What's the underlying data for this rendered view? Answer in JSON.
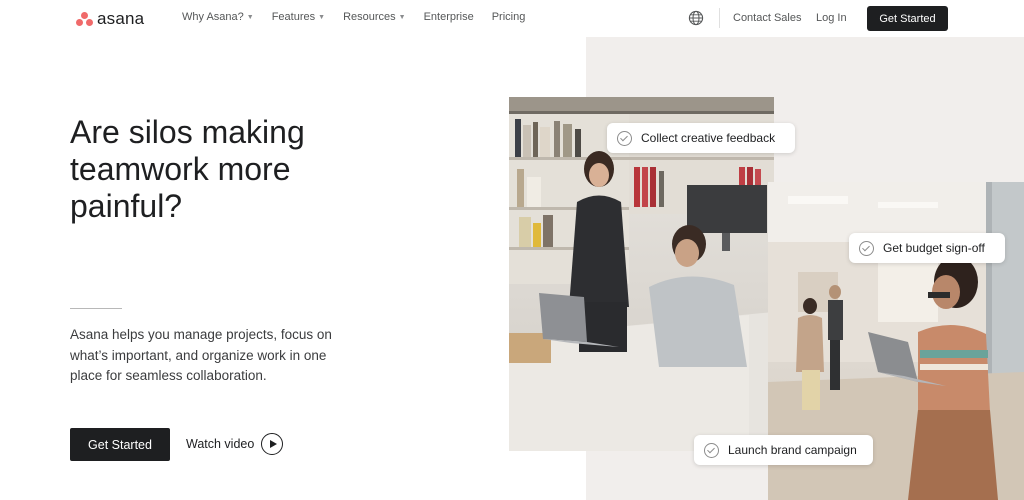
{
  "nav": {
    "logo_text": "asana",
    "links": [
      {
        "label": "Why Asana?",
        "has_dropdown": true
      },
      {
        "label": "Features",
        "has_dropdown": true
      },
      {
        "label": "Resources",
        "has_dropdown": true
      },
      {
        "label": "Enterprise",
        "has_dropdown": false
      },
      {
        "label": "Pricing",
        "has_dropdown": false
      }
    ],
    "globe_icon": "globe-icon",
    "contact_sales": "Contact Sales",
    "log_in": "Log In",
    "cta": "Get Started"
  },
  "hero": {
    "headline": "Are silos making teamwork more painful?",
    "subtext": "Asana helps you manage projects, focus on what’s important, and organize work in one place for seamless collaboration.",
    "cta_primary": "Get Started",
    "watch_video": "Watch video",
    "play_icon": "play-circle-icon"
  },
  "chips": [
    {
      "label": "Collect creative feedback"
    },
    {
      "label": "Get budget sign-off"
    },
    {
      "label": "Launch brand campaign"
    }
  ],
  "colors": {
    "brand_coral": "#f06a6a",
    "dark": "#1e1f21",
    "panel_bg": "#f1eeec"
  }
}
